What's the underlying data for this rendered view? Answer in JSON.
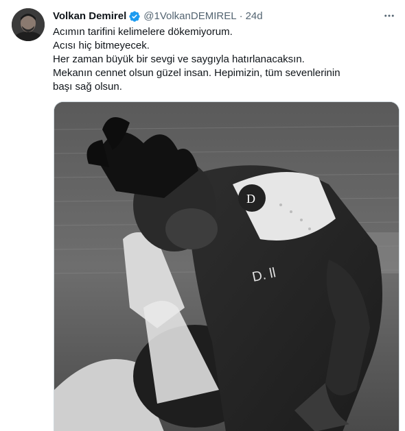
{
  "tweet": {
    "author_name": "Volkan Demirel",
    "handle": "@1VolkanDEMIREL",
    "separator": "·",
    "time": "24d",
    "verified": true,
    "lines": [
      "Acımın tarifini kelimelere dökemiyorum.",
      "Acısı hiç bitmeyecek.",
      "Her zaman büyük bir sevgi ve saygıyla hatırlanacaksın.",
      "Mekanın cennet olsun güzel insan. Hepimizin, tüm sevenlerinin başı sağ olsun."
    ],
    "media": {
      "style": "black-and-white",
      "jersey_badge_text": "D"
    }
  },
  "icons": {
    "verified": "verified-badge-icon",
    "more": "more-options-icon"
  },
  "colors": {
    "primary_text": "#0f1419",
    "secondary_text": "#536471",
    "verified_blue": "#1d9bf0",
    "border": "#cfd9de"
  }
}
